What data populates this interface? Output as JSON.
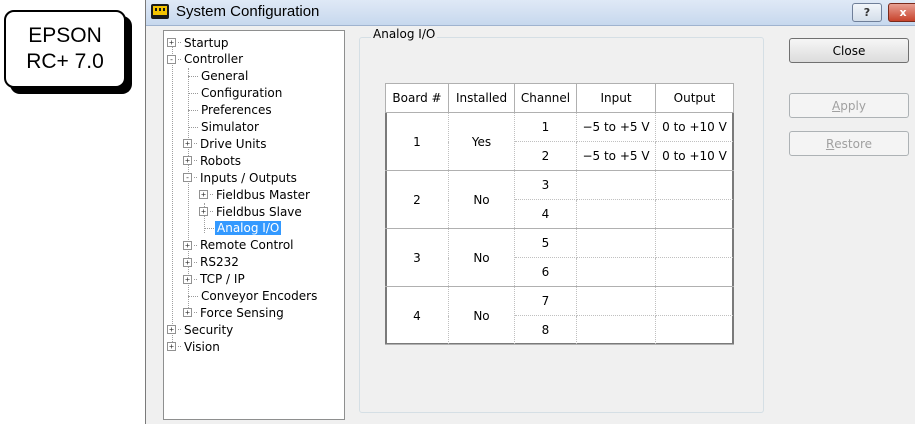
{
  "badge": {
    "line1": "EPSON",
    "line2": "RC+ 7.0"
  },
  "window": {
    "title": "System Configuration",
    "help_label": "?",
    "close_label": "x"
  },
  "tree": {
    "items": [
      {
        "label": "Startup",
        "expander": "+"
      },
      {
        "label": "Controller",
        "expander": "-"
      },
      {
        "label": "General"
      },
      {
        "label": "Configuration"
      },
      {
        "label": "Preferences"
      },
      {
        "label": "Simulator"
      },
      {
        "label": "Drive Units",
        "expander": "+"
      },
      {
        "label": "Robots",
        "expander": "+"
      },
      {
        "label": "Inputs / Outputs",
        "expander": "-"
      },
      {
        "label": "Fieldbus Master",
        "expander": "+"
      },
      {
        "label": "Fieldbus Slave",
        "expander": "+"
      },
      {
        "label": "Analog I/O",
        "selected": true
      },
      {
        "label": "Remote Control",
        "expander": "+"
      },
      {
        "label": "RS232",
        "expander": "+"
      },
      {
        "label": "TCP / IP",
        "expander": "+"
      },
      {
        "label": "Conveyor Encoders"
      },
      {
        "label": "Force Sensing",
        "expander": "+"
      },
      {
        "label": "Security",
        "expander": "+"
      },
      {
        "label": "Vision",
        "expander": "+"
      }
    ]
  },
  "panel": {
    "group_title": "Analog I/O",
    "table": {
      "headers": [
        "Board #",
        "Installed",
        "Channel",
        "Input",
        "Output"
      ],
      "boards": [
        {
          "board": "1",
          "installed": "Yes",
          "channels": [
            {
              "channel": "1",
              "input": "−5 to +5 V",
              "output": "0 to +10 V"
            },
            {
              "channel": "2",
              "input": "−5 to +5 V",
              "output": "0 to +10 V"
            }
          ]
        },
        {
          "board": "2",
          "installed": "No",
          "channels": [
            {
              "channel": "3",
              "input": "",
              "output": ""
            },
            {
              "channel": "4",
              "input": "",
              "output": ""
            }
          ]
        },
        {
          "board": "3",
          "installed": "No",
          "channels": [
            {
              "channel": "5",
              "input": "",
              "output": ""
            },
            {
              "channel": "6",
              "input": "",
              "output": ""
            }
          ]
        },
        {
          "board": "4",
          "installed": "No",
          "channels": [
            {
              "channel": "7",
              "input": "",
              "output": ""
            },
            {
              "channel": "8",
              "input": "",
              "output": ""
            }
          ]
        }
      ]
    }
  },
  "buttons": {
    "close": "Close",
    "apply_mnemonic": "A",
    "apply_rest": "pply",
    "restore_mnemonic": "R",
    "restore_rest": "estore"
  }
}
